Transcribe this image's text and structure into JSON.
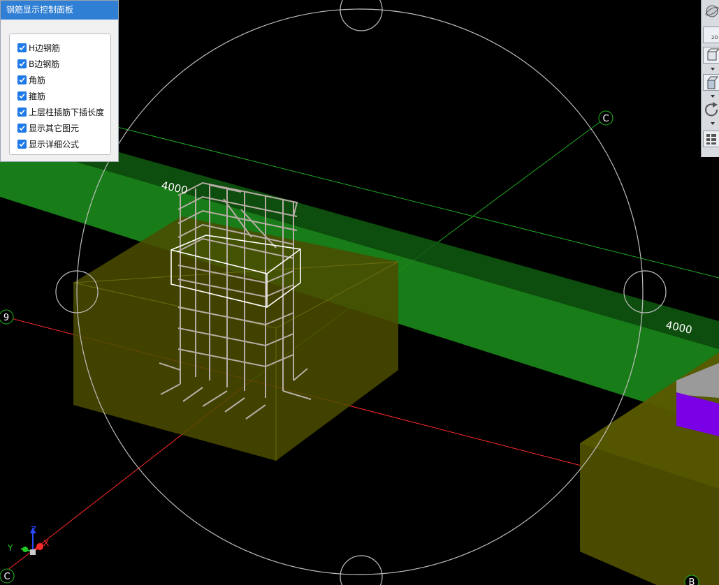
{
  "panel": {
    "title": "钢筋显示控制面板",
    "options": [
      {
        "label": "H边钢筋",
        "checked": true
      },
      {
        "label": "B边钢筋",
        "checked": true
      },
      {
        "label": "角筋",
        "checked": true
      },
      {
        "label": "箍筋",
        "checked": true
      },
      {
        "label": "上层柱插筋下插长度",
        "checked": true
      },
      {
        "label": "显示其它图元",
        "checked": true
      },
      {
        "label": "显示详细公式",
        "checked": true
      }
    ]
  },
  "viewport": {
    "dimensions": [
      "4000",
      "4000"
    ],
    "axis_markers": [
      "C",
      "9",
      "C",
      "B"
    ],
    "gizmo": {
      "x": "X",
      "y": "Y",
      "z": "Z"
    },
    "colors": {
      "beam": "#1f8f1f",
      "footing": "#5a5a00",
      "rebar": "#b8ada6",
      "axis_red": "#ff2a2a",
      "axis_green": "#22bb22",
      "orbit": "#bfbfbf",
      "purple": "#7a00e6"
    }
  },
  "toolbar": {
    "view_2d_label": "2D",
    "icons": [
      "orbit-icon",
      "view-2d-icon",
      "view-box-icon",
      "view-cube-icon",
      "rotate-icon",
      "settings-grid-icon"
    ]
  }
}
